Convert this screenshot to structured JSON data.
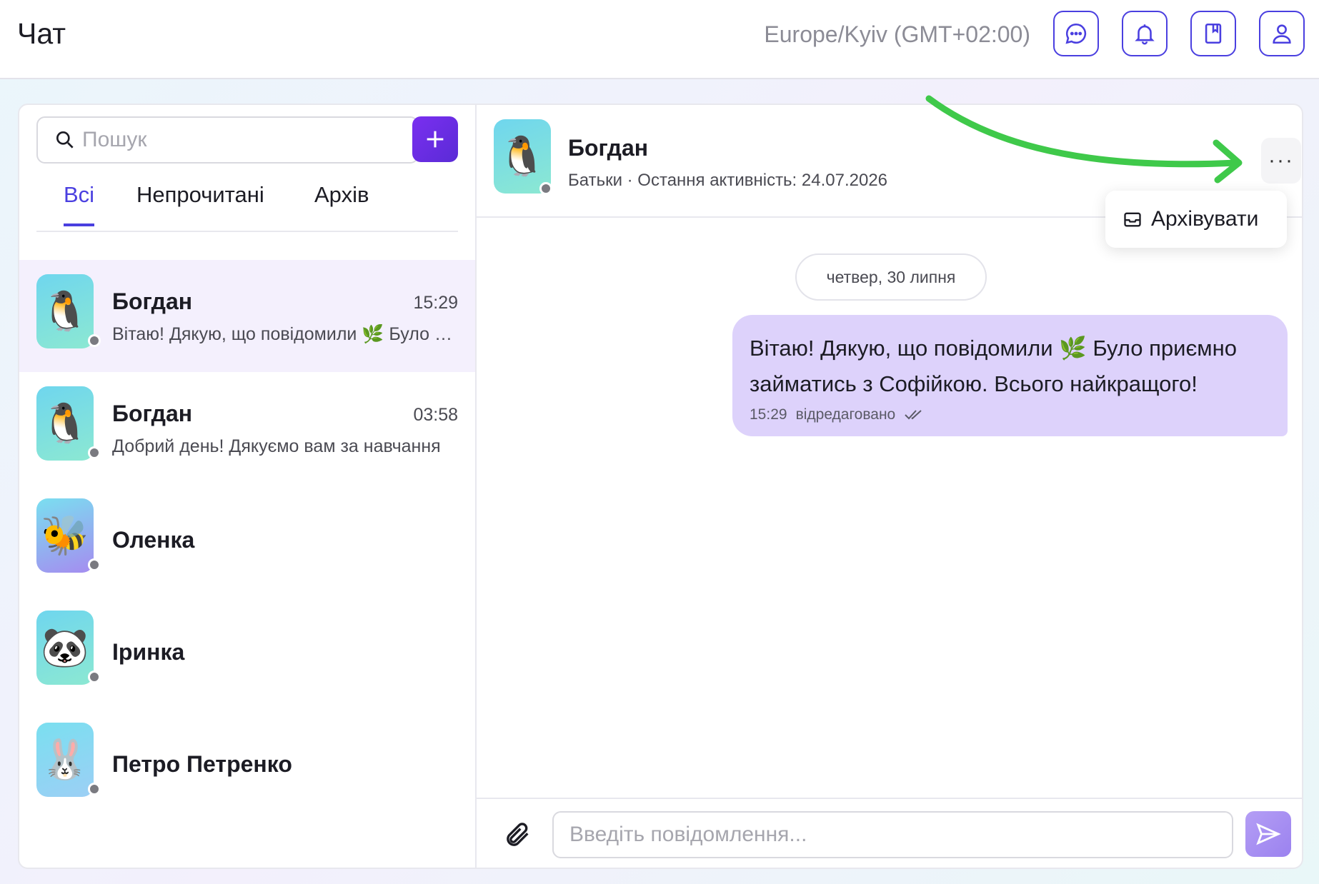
{
  "header": {
    "title": "Чат",
    "timezone": "Europe/Kyiv (GMT+02:00)",
    "icons": [
      "chat-icon",
      "bell-icon",
      "bookmark-book-icon",
      "user-icon"
    ],
    "accent": "#4a3fe0"
  },
  "sidebar": {
    "search_placeholder": "Пошук",
    "tabs": [
      {
        "label": "Всі",
        "active": true
      },
      {
        "label": "Непрочитані",
        "active": false
      },
      {
        "label": "Архів",
        "active": false
      }
    ],
    "chats": [
      {
        "name": "Богдан",
        "time": "15:29",
        "preview": "Вітаю! Дякую, що повідомили 🌿 Було приємно займатись з Софійкою. Всього найкращого!",
        "avatar": "penguin",
        "selected": true
      },
      {
        "name": "Богдан",
        "time": "03:58",
        "preview": "Добрий день! Дякуємо вам за навчання",
        "avatar": "penguin",
        "selected": false
      },
      {
        "name": "Оленка",
        "time": "",
        "preview": "",
        "avatar": "bee",
        "selected": false
      },
      {
        "name": "Іринка",
        "time": "",
        "preview": "",
        "avatar": "panda",
        "selected": false
      },
      {
        "name": "Петро Петренко",
        "time": "",
        "preview": "",
        "avatar": "bunny",
        "selected": false
      }
    ]
  },
  "conversation": {
    "name": "Богдан",
    "subtitle": "Батьки · Остання активність: 24.07.2026",
    "menu_item": "Архівувати",
    "date_divider": "четвер, 30 липня",
    "message": {
      "text": "Вітаю! Дякую, що повідомили 🌿 Було приємно займатись з Софійкою. Всього найкращого!",
      "time": "15:29",
      "status": "відредаговано"
    },
    "composer_placeholder": "Введіть повідомлення..."
  }
}
